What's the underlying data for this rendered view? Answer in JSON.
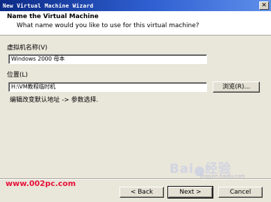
{
  "window": {
    "title": "New Virtual Machine Wizard"
  },
  "header": {
    "title": "Name the Virtual Machine",
    "subtitle": "What name would you like to use for this virtual machine?"
  },
  "form": {
    "name_label": "虚拟机名称(V)",
    "name_value": "Windows 2000 母本",
    "location_label": "位置(L)",
    "location_value": "H:\\VM教程临时机",
    "browse_label": "浏览(R)...",
    "hint": "编辑改变默认地址 -> 参数选择."
  },
  "buttons": {
    "back": "< Back",
    "next": "Next >",
    "cancel": "Cancel"
  },
  "watermarks": {
    "site": "www.002pc.com",
    "baidu_a": "Bai",
    "baidu_b": "经验",
    "baidu_url": "jingyan.baidu.com"
  }
}
